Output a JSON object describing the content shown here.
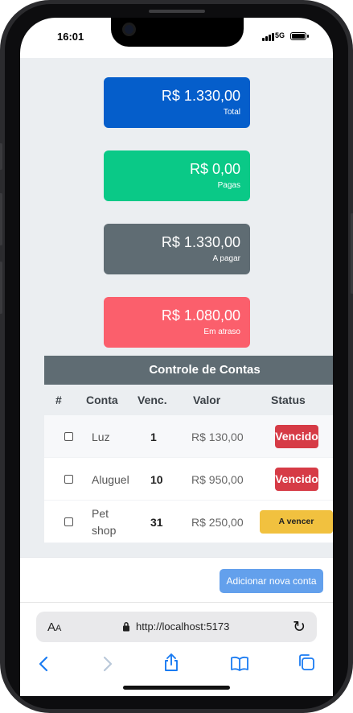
{
  "status_bar": {
    "time": "16:01",
    "network": "5G"
  },
  "cards": [
    {
      "amount": "R$ 1.330,00",
      "label": "Total",
      "color": "#055ecb"
    },
    {
      "amount": "R$ 0,00",
      "label": "Pagas",
      "color": "#0ac987"
    },
    {
      "amount": "R$ 1.330,00",
      "label": "A pagar",
      "color": "#5f6c73"
    },
    {
      "amount": "R$ 1.080,00",
      "label": "Em atraso",
      "color": "#fb5f6c"
    }
  ],
  "table": {
    "title": "Controle de Contas",
    "headers": {
      "num": "#",
      "conta": "Conta",
      "venc": "Venc.",
      "valor": "Valor",
      "status": "Status"
    },
    "rows": [
      {
        "conta": "Luz",
        "venc": "1",
        "valor": "R$ 130,00",
        "status": "Vencido"
      },
      {
        "conta": "Aluguel",
        "venc": "10",
        "valor": "R$ 950,00",
        "status": "Vencido"
      },
      {
        "conta_line1": "Pet",
        "conta_line2": "shop",
        "venc": "31",
        "valor": "R$ 250,00",
        "status": "A vencer"
      }
    ]
  },
  "add_button": {
    "label": "Adicionar nova conta"
  },
  "browser": {
    "aa_big": "A",
    "aa_small": "A",
    "url": "http://localhost:5173"
  }
}
